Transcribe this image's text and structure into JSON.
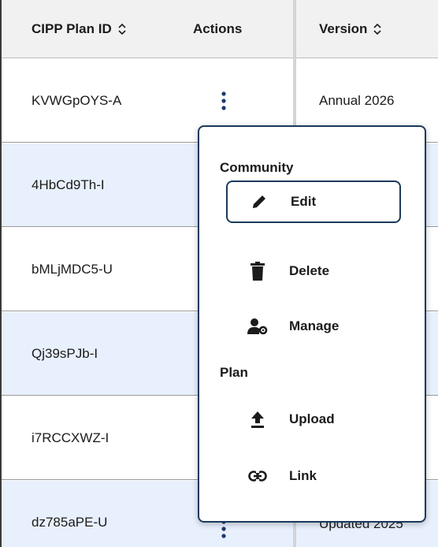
{
  "columns": [
    {
      "label": "CIPP Plan ID",
      "sortable": true
    },
    {
      "label": "Actions",
      "sortable": false
    },
    {
      "label": "Version",
      "sortable": true
    }
  ],
  "rows": [
    {
      "id": "KVWGpOYS-A",
      "version": "Annual 2026"
    },
    {
      "id": "4HbCd9Th-I",
      "version": ""
    },
    {
      "id": "bMLjMDC5-U",
      "version": ""
    },
    {
      "id": "Qj39sPJb-I",
      "version": ""
    },
    {
      "id": "i7RCCXWZ-I",
      "version": ""
    },
    {
      "id": "dz785aPE-U",
      "version": "Updated 2025"
    }
  ],
  "menu": {
    "groups": [
      {
        "title": "Community",
        "items": [
          {
            "label": "Edit",
            "icon": "pencil-icon"
          },
          {
            "label": "Delete",
            "icon": "trash-icon"
          },
          {
            "label": "Manage",
            "icon": "user-gear-icon"
          }
        ]
      },
      {
        "title": "Plan",
        "items": [
          {
            "label": "Upload",
            "icon": "upload-icon"
          },
          {
            "label": "Link",
            "icon": "link-icon"
          }
        ]
      }
    ],
    "focused_item": "Edit"
  },
  "colors": {
    "header_bg": "#f1f1f1",
    "row_alt_bg": "#e8f0fd",
    "accent": "#1b3a5c",
    "kebab": "#1a3a6b"
  }
}
